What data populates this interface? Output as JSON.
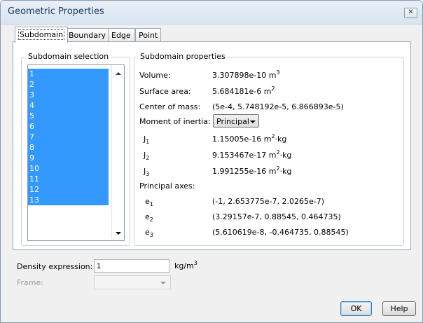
{
  "window": {
    "title": "Geometric Properties",
    "close_label": "✕"
  },
  "tabs": [
    {
      "label": "Subdomain"
    },
    {
      "label": "Boundary"
    },
    {
      "label": "Edge"
    },
    {
      "label": "Point"
    }
  ],
  "subdomain_selection": {
    "title": "Subdomain selection",
    "items": [
      "1",
      "2",
      "3",
      "4",
      "5",
      "6",
      "7",
      "8",
      "9",
      "10",
      "11",
      "12",
      "13"
    ]
  },
  "properties": {
    "title": "Subdomain properties",
    "volume_label": "Volume:",
    "volume_value": "3.307898e-10",
    "volume_unit": "m",
    "volume_unit_exp": "3",
    "surface_label": "Surface area:",
    "surface_value": "5.684181e-6",
    "surface_unit": "m",
    "surface_unit_exp": "2",
    "center_label": "Center of mass:",
    "center_value": "(5e-4, 5.748192e-5, 6.866893e-5)",
    "moment_label": "Moment of inertia:",
    "moment_selected": "Principal",
    "j_symbol": "J",
    "j1_sub": "1",
    "j1_value": "1.15005e-16",
    "j2_sub": "2",
    "j2_value": "9.153467e-17",
    "j3_sub": "3",
    "j3_value": "1.991255e-16",
    "j_unit_m": "m",
    "j_unit_exp": "2",
    "j_unit_kg": "·kg",
    "axes_label": "Principal axes:",
    "e_symbol": "e",
    "e1_sub": "1",
    "e1_value": "(-1, 2.653775e-7, 2.0265e-7)",
    "e2_sub": "2",
    "e2_value": "(3.29157e-7, 0.88545, 0.464735)",
    "e3_sub": "3",
    "e3_value": "(5.610619e-8, -0.464735, 0.88545)"
  },
  "density": {
    "label": "Density expression:",
    "value": "1",
    "unit": "kg/m",
    "unit_exp": "3"
  },
  "frame": {
    "label": "Frame:",
    "value": ""
  },
  "buttons": {
    "ok": "OK",
    "help": "Help"
  }
}
